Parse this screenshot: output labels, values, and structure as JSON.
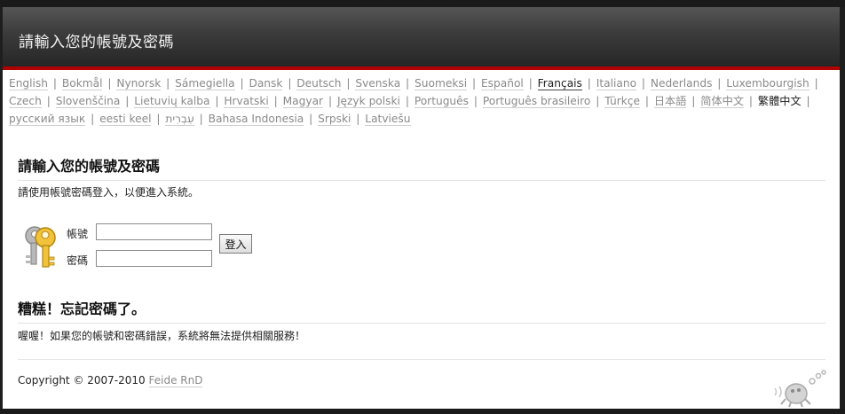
{
  "header": {
    "title": "請輸入您的帳號及密碼"
  },
  "languages": [
    {
      "label": "English"
    },
    {
      "label": "Bokmål"
    },
    {
      "label": "Nynorsk"
    },
    {
      "label": "Sámegiella"
    },
    {
      "label": "Dansk"
    },
    {
      "label": "Deutsch"
    },
    {
      "label": "Svenska"
    },
    {
      "label": "Suomeksi"
    },
    {
      "label": "Español"
    },
    {
      "label": "Français",
      "state": "active"
    },
    {
      "label": "Italiano"
    },
    {
      "label": "Nederlands"
    },
    {
      "label": "Luxembourgish"
    },
    {
      "label": "Czech"
    },
    {
      "label": "Slovenščina"
    },
    {
      "label": "Lietuvių kalba"
    },
    {
      "label": "Hrvatski"
    },
    {
      "label": "Magyar"
    },
    {
      "label": "Język polski"
    },
    {
      "label": "Português"
    },
    {
      "label": "Português brasileiro"
    },
    {
      "label": "Türkçe"
    },
    {
      "label": "日本語"
    },
    {
      "label": "简体中文"
    },
    {
      "label": "繁體中文",
      "state": "current"
    },
    {
      "label": "русский язык"
    },
    {
      "label": "eesti keel"
    },
    {
      "label": "עִבְרִית"
    },
    {
      "label": "Bahasa Indonesia"
    },
    {
      "label": "Srpski"
    },
    {
      "label": "Latviešu"
    }
  ],
  "login": {
    "title": "請輸入您的帳號及密碼",
    "description": "請使用帳號密碼登入，以便進入系統。",
    "username_label": "帳號",
    "username_value": "",
    "password_label": "密碼",
    "password_value": "",
    "submit_label": "登入"
  },
  "forgot": {
    "title": "糟糕！忘記密碼了。",
    "description": "喔喔！如果您的帳號和密碼錯誤，系統將無法提供相關服務！"
  },
  "footer": {
    "copyright_text": "Copyright © 2007-2010",
    "link_text": "Feide RnD"
  },
  "icons": {
    "keys": "keys-icon",
    "mascot": "feide-mascot-icon"
  },
  "colors": {
    "accent_red": "#b00000",
    "header_dark": "#333333",
    "link_gray": "#8a8a8a"
  }
}
